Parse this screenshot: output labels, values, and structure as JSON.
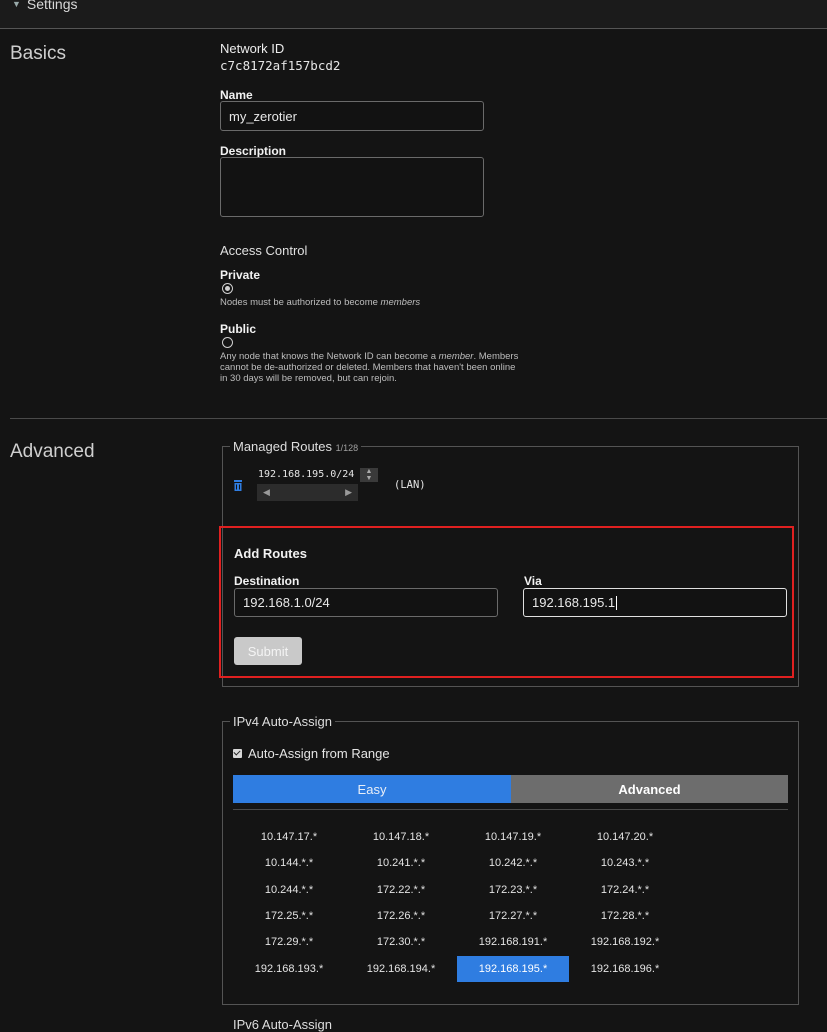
{
  "header": {
    "settings_label": "Settings"
  },
  "basics": {
    "section_title": "Basics",
    "network_id_label": "Network ID",
    "network_id": "c7c8172af157bcd2",
    "name_label": "Name",
    "name_value": "my_zerotier",
    "description_label": "Description",
    "description_value": "",
    "access_control_title": "Access Control",
    "private_label": "Private",
    "private_help_prefix": "Nodes must be authorized to become ",
    "private_help_em": "members",
    "public_label": "Public",
    "public_help_prefix": "Any node that knows the Network ID can become a ",
    "public_help_em": "member",
    "public_help_suffix": ". Members cannot be de-authorized or deleted. Members that haven't been online in 30 days will be removed, but can rejoin.",
    "selected_access": "private"
  },
  "advanced": {
    "section_title": "Advanced",
    "managed_routes": {
      "legend": "Managed Routes",
      "count": "1/128",
      "routes": [
        {
          "target": "192.168.195.0/24",
          "via": "(LAN)"
        }
      ]
    },
    "add_routes": {
      "title": "Add Routes",
      "destination_label": "Destination",
      "destination_value": "192.168.1.0/24",
      "via_label": "Via",
      "via_value": "192.168.195.1",
      "submit_label": "Submit"
    },
    "ipv4_auto_assign": {
      "legend": "IPv4 Auto-Assign",
      "checkbox_label": "Auto-Assign from Range",
      "checked": true,
      "tabs": {
        "easy": "Easy",
        "advanced": "Advanced"
      },
      "active_tab": "Easy",
      "pools": [
        [
          "10.147.17.*",
          "10.147.18.*",
          "10.147.19.*",
          "10.147.20.*"
        ],
        [
          "10.144.*.*",
          "10.241.*.*",
          "10.242.*.*",
          "10.243.*.*"
        ],
        [
          "10.244.*.*",
          "172.22.*.*",
          "172.23.*.*",
          "172.24.*.*"
        ],
        [
          "172.25.*.*",
          "172.26.*.*",
          "172.27.*.*",
          "172.28.*.*"
        ],
        [
          "172.29.*.*",
          "172.30.*.*",
          "192.168.191.*",
          "192.168.192.*"
        ],
        [
          "192.168.193.*",
          "192.168.194.*",
          "192.168.195.*",
          "192.168.196.*"
        ]
      ],
      "selected_pool": "192.168.195.*"
    },
    "ipv6_auto_assign": {
      "legend": "IPv6 Auto-Assign"
    }
  },
  "colors": {
    "accent": "#2f7de1",
    "highlight_border": "#e02020",
    "background": "#141414"
  }
}
